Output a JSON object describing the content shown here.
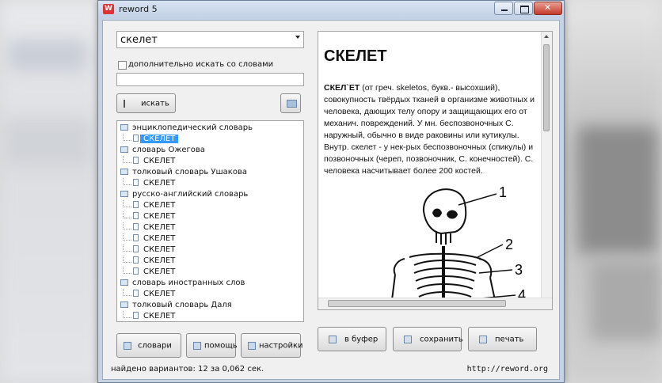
{
  "window": {
    "title": "reword 5",
    "icon": "reword-app-icon"
  },
  "search": {
    "query": "скелет",
    "also_search_label": "дополнительно искать со словами",
    "also_search_checked": false,
    "extra_words": "",
    "search_button": "искать"
  },
  "tree": {
    "dictionaries": [
      {
        "name": "энциклопедический словарь",
        "entries": [
          "СКЕЛЕТ"
        ]
      },
      {
        "name": "словарь Ожегова",
        "entries": [
          "СКЕЛЕТ"
        ]
      },
      {
        "name": "толковый словарь Ушакова",
        "entries": [
          "СКЕЛЕТ"
        ]
      },
      {
        "name": "русско-английский словарь",
        "entries": [
          "СКЕЛЕТ",
          "СКЕЛЕТ",
          "СКЕЛЕТ",
          "СКЕЛЕТ",
          "СКЕЛЕТ",
          "СКЕЛЕТ",
          "СКЕЛЕТ"
        ]
      },
      {
        "name": "словарь иностранных слов",
        "entries": [
          "СКЕЛЕТ"
        ]
      },
      {
        "name": "толковый словарь Даля",
        "entries": [
          "СКЕЛЕТ"
        ]
      }
    ],
    "selected": "энциклопедический словарь / СКЕЛЕТ"
  },
  "left_buttons": {
    "dictionaries": "словари",
    "help": "помощь",
    "settings": "настройки"
  },
  "article": {
    "title": "СКЕЛЕТ",
    "headword": "СКЕЛ`ЕТ",
    "text": " (от греч. skeletos, букв.- высохший), совокупность твёрдых тканей в организме животных и человека, дающих телу опору и защищающих его от механич. повреждений. У мн. беспозвоночных С. наружный, обычно в виде раковины или кутикулы. Внутр. скелет - у нек-рых беспозвоночных (спикулы) и позвоночных (череп, позвоночник, С. конечностей). С. человека насчитывает более 200 костей.",
    "figure_labels": [
      "1",
      "2",
      "3",
      "4"
    ]
  },
  "right_buttons": {
    "to_buffer": "в буфер",
    "save": "сохранить",
    "print": "печать"
  },
  "status": {
    "found": "найдено вариантов: 12 за 0,062 сек.",
    "url": "http://reword.org"
  }
}
